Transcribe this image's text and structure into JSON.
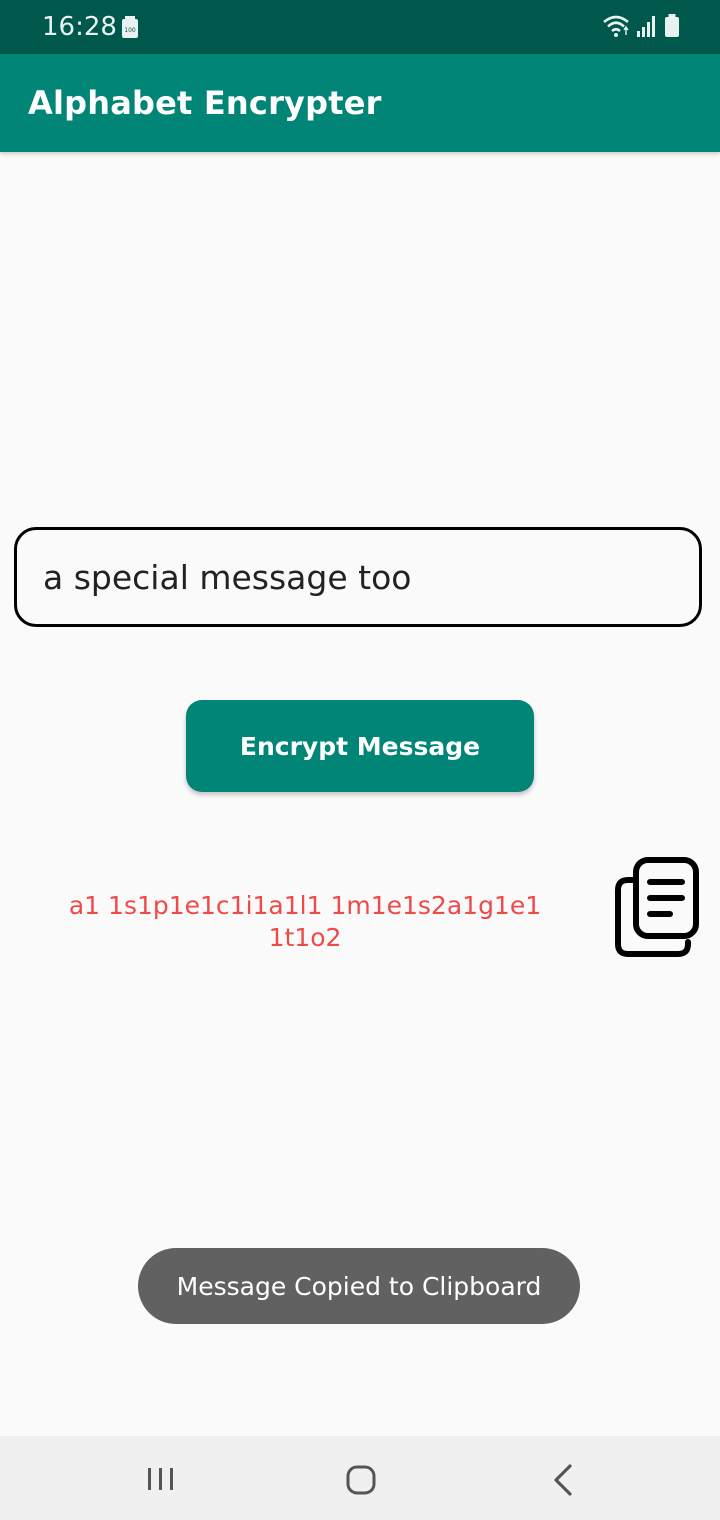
{
  "status_bar": {
    "time": "16:28",
    "battery_badge": "100",
    "icons": [
      "battery-saver-icon",
      "wifi-icon",
      "signal-icon",
      "battery-icon"
    ]
  },
  "app_bar": {
    "title": "Alphabet Encrypter"
  },
  "input": {
    "value": "a special message too"
  },
  "encrypt_button": {
    "label": "Encrypt Message"
  },
  "result": {
    "text": "a1 1s1p1e1c1i1a1l1 1m1e1s2a1g1e1 1t1o2"
  },
  "copy_button": {
    "icon": "copy-icon"
  },
  "toast": {
    "message": "Message Copied to Clipboard"
  },
  "nav_bar": {
    "icons": [
      "recent-apps-icon",
      "home-icon",
      "back-icon"
    ]
  },
  "colors": {
    "status_bar": "#00574b",
    "app_bar": "#008577",
    "button": "#008577",
    "result_text": "#ef4a4a",
    "toast": "#616161",
    "background": "#fafafa"
  }
}
